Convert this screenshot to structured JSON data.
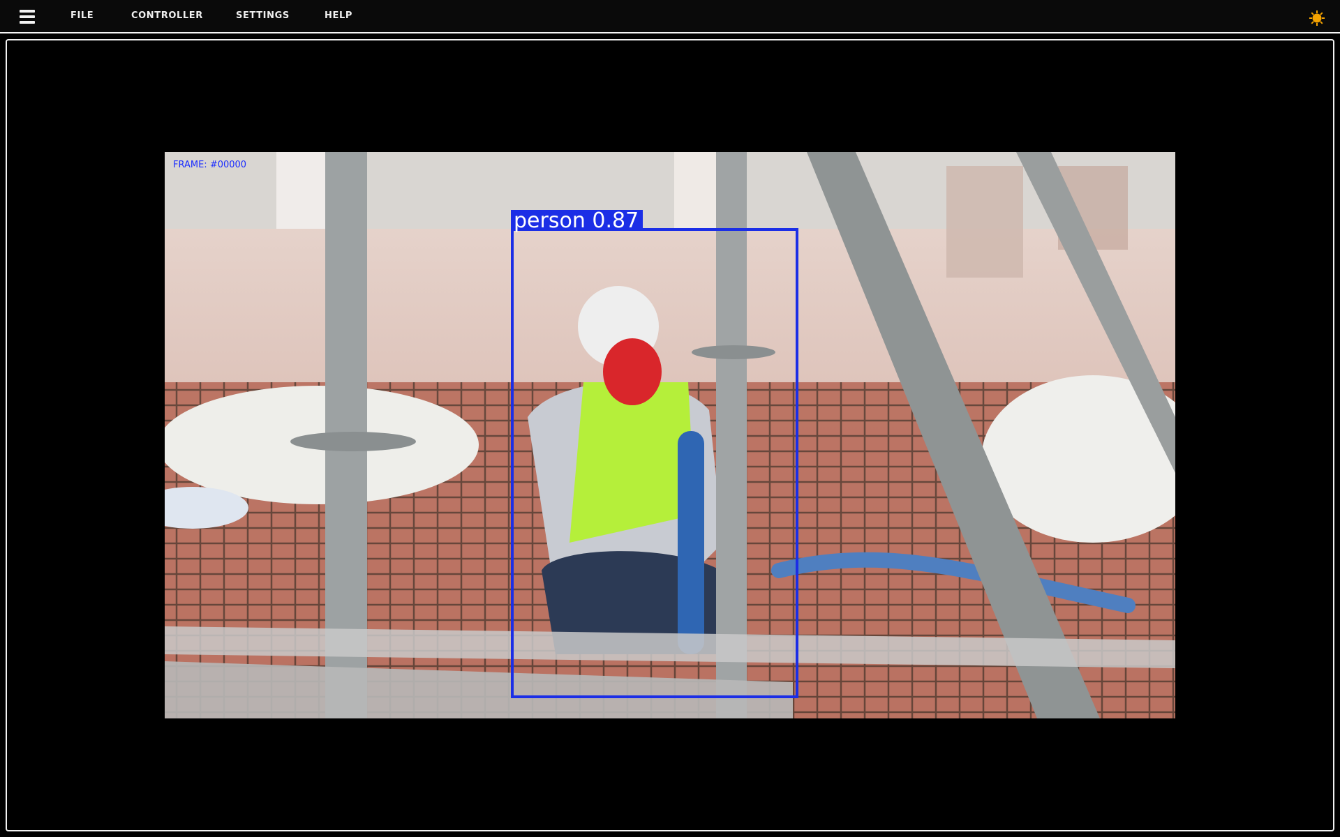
{
  "menubar": {
    "items": [
      {
        "label": "FILE"
      },
      {
        "label": "CONTROLLER"
      },
      {
        "label": "SETTINGS"
      },
      {
        "label": "HELP"
      }
    ],
    "icons": {
      "left": "hamburger-menu-icon",
      "right": "sun-icon"
    },
    "colors": {
      "background": "#0a0a0a",
      "text": "#f0f0f0",
      "sun": "#f5a300"
    }
  },
  "video": {
    "overlay": {
      "frame_counter": "FRAME: #00000",
      "status": "",
      "frame_color": "#1a2cff"
    },
    "detection": {
      "class_label": "person",
      "confidence": "0.87",
      "color": "#1b2ee6"
    }
  }
}
